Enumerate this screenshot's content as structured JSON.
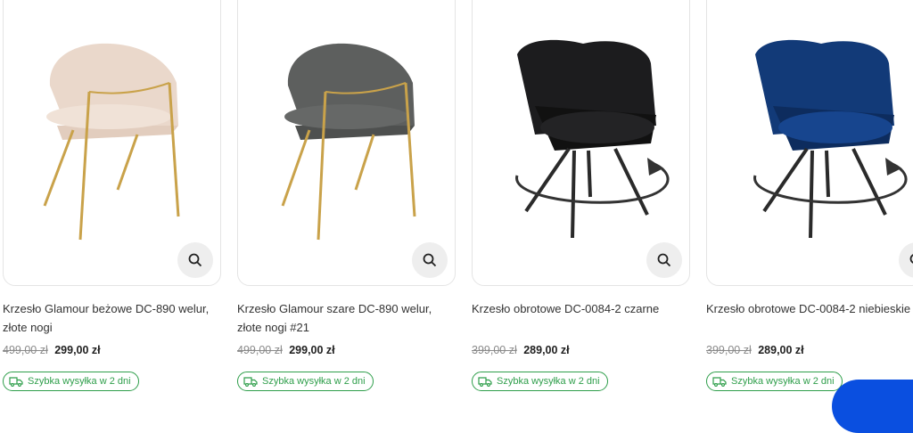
{
  "products": [
    {
      "title": "Krzesło Glamour beżowe DC-890 welur, złote nogi",
      "old_price": "499,00 zł",
      "price": "299,00 zł",
      "shipping": "Szybka wysyłka w 2 dni",
      "image": "beige-velvet-chair-gold-legs",
      "image_colors": {
        "upholstery": "#ead8cb",
        "legs": "#c9a24a"
      }
    },
    {
      "title": "Krzesło Glamour szare DC-890 welur, złote nogi #21",
      "old_price": "499,00 zł",
      "price": "299,00 zł",
      "shipping": "Szybka wysyłka w 2 dni",
      "image": "grey-velvet-chair-gold-legs",
      "image_colors": {
        "upholstery": "#5d5f5e",
        "legs": "#c9a24a"
      }
    },
    {
      "title": "Krzesło obrotowe DC-0084-2 czarne",
      "old_price": "399,00 zł",
      "price": "289,00 zł",
      "shipping": "Szybka wysyłka w 2 dni",
      "image": "black-swivel-chair",
      "image_colors": {
        "upholstery": "#1c1c1e",
        "legs": "#2a2a2a"
      }
    },
    {
      "title": "Krzesło obrotowe DC-0084-2 niebieskie",
      "old_price": "399,00 zł",
      "price": "289,00 zł",
      "shipping": "Szybka wysyłka w 2 dni",
      "image": "blue-swivel-chair",
      "image_colors": {
        "upholstery": "#123a78",
        "legs": "#2a2a2a"
      }
    }
  ],
  "icons": {
    "zoom": "search-icon",
    "shipping": "truck-icon"
  },
  "colors": {
    "shipping_accent": "#2e9e4a",
    "fab": "#0a4fe0"
  }
}
